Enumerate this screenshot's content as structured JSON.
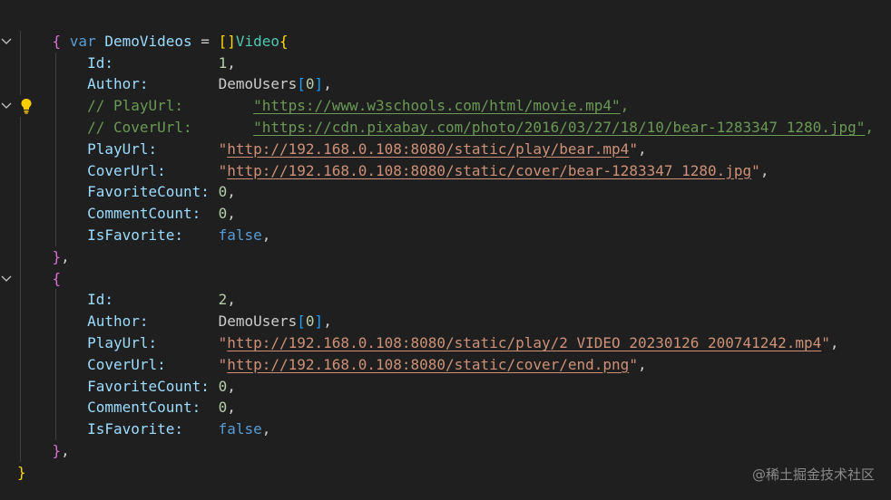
{
  "code": {
    "decl_keyword": "var",
    "decl_name": "DemoVideos",
    "decl_eq": " = ",
    "decl_slice": "[]",
    "decl_type": "Video",
    "open_outer": "{",
    "close_outer": "}",
    "open_obj": "{",
    "close_obj": "}",
    "obj_comma": ",",
    "objects": [
      {
        "fields": [
          {
            "key": "Id:",
            "pad": "            ",
            "value": "1",
            "kind": "num",
            "tail": ","
          },
          {
            "key": "Author:",
            "pad": "        ",
            "value": "DemoUsers",
            "kind": "ref",
            "idx": "0",
            "tail": ","
          },
          {
            "key": "// PlayUrl:",
            "pad": "        ",
            "value": "\"https://www.w3schools.com/html/movie.mp4\"",
            "kind": "comment",
            "tail": ","
          },
          {
            "key": "// CoverUrl:",
            "pad": "       ",
            "value": "\"https://cdn.pixabay.com/photo/2016/03/27/18/10/bear-1283347_1280.jpg\"",
            "kind": "comment",
            "tail": ","
          },
          {
            "key": "PlayUrl:",
            "pad": "       ",
            "q": "\"",
            "url": "http://192.168.0.108:8080/static/play/bear.mp4",
            "kind": "str",
            "tail": ","
          },
          {
            "key": "CoverUrl:",
            "pad": "      ",
            "q": "\"",
            "url": "http://192.168.0.108:8080/static/cover/bear-1283347_1280.jpg",
            "kind": "str",
            "tail": ","
          },
          {
            "key": "FavoriteCount:",
            "pad": " ",
            "value": "0",
            "kind": "num",
            "tail": ","
          },
          {
            "key": "CommentCount:",
            "pad": "  ",
            "value": "0",
            "kind": "num",
            "tail": ","
          },
          {
            "key": "IsFavorite:",
            "pad": "    ",
            "value": "false",
            "kind": "bool",
            "tail": ","
          }
        ]
      },
      {
        "fields": [
          {
            "key": "Id:",
            "pad": "            ",
            "value": "2",
            "kind": "num",
            "tail": ","
          },
          {
            "key": "Author:",
            "pad": "        ",
            "value": "DemoUsers",
            "kind": "ref",
            "idx": "0",
            "tail": ","
          },
          {
            "key": "PlayUrl:",
            "pad": "       ",
            "q": "\"",
            "url": "http://192.168.0.108:8080/static/play/2_VIDEO_20230126_200741242.mp4",
            "kind": "str",
            "tail": ","
          },
          {
            "key": "CoverUrl:",
            "pad": "      ",
            "q": "\"",
            "url": "http://192.168.0.108:8080/static/cover/end.png",
            "kind": "str",
            "tail": ","
          },
          {
            "key": "FavoriteCount:",
            "pad": " ",
            "value": "0",
            "kind": "num",
            "tail": ","
          },
          {
            "key": "CommentCount:",
            "pad": "  ",
            "value": "0",
            "kind": "num",
            "tail": ","
          },
          {
            "key": "IsFavorite:",
            "pad": "    ",
            "value": "false",
            "kind": "bool",
            "tail": ","
          }
        ]
      }
    ]
  },
  "icons": {
    "fold": "chevron-down-icon",
    "bulb": "lightbulb-icon"
  },
  "watermark": "@稀土掘金技术社区",
  "colors": {
    "background": "#1f1f1f",
    "keyword": "#569cd6",
    "variable": "#9cdcfe",
    "type": "#4ec9b0",
    "string": "#ce9178",
    "number": "#b5cea8",
    "comment": "#6a9955",
    "bracket_yellow": "#ffd700",
    "bracket_purple": "#da70d6",
    "bracket_blue": "#179fff",
    "bulb": "#ffcc00"
  }
}
